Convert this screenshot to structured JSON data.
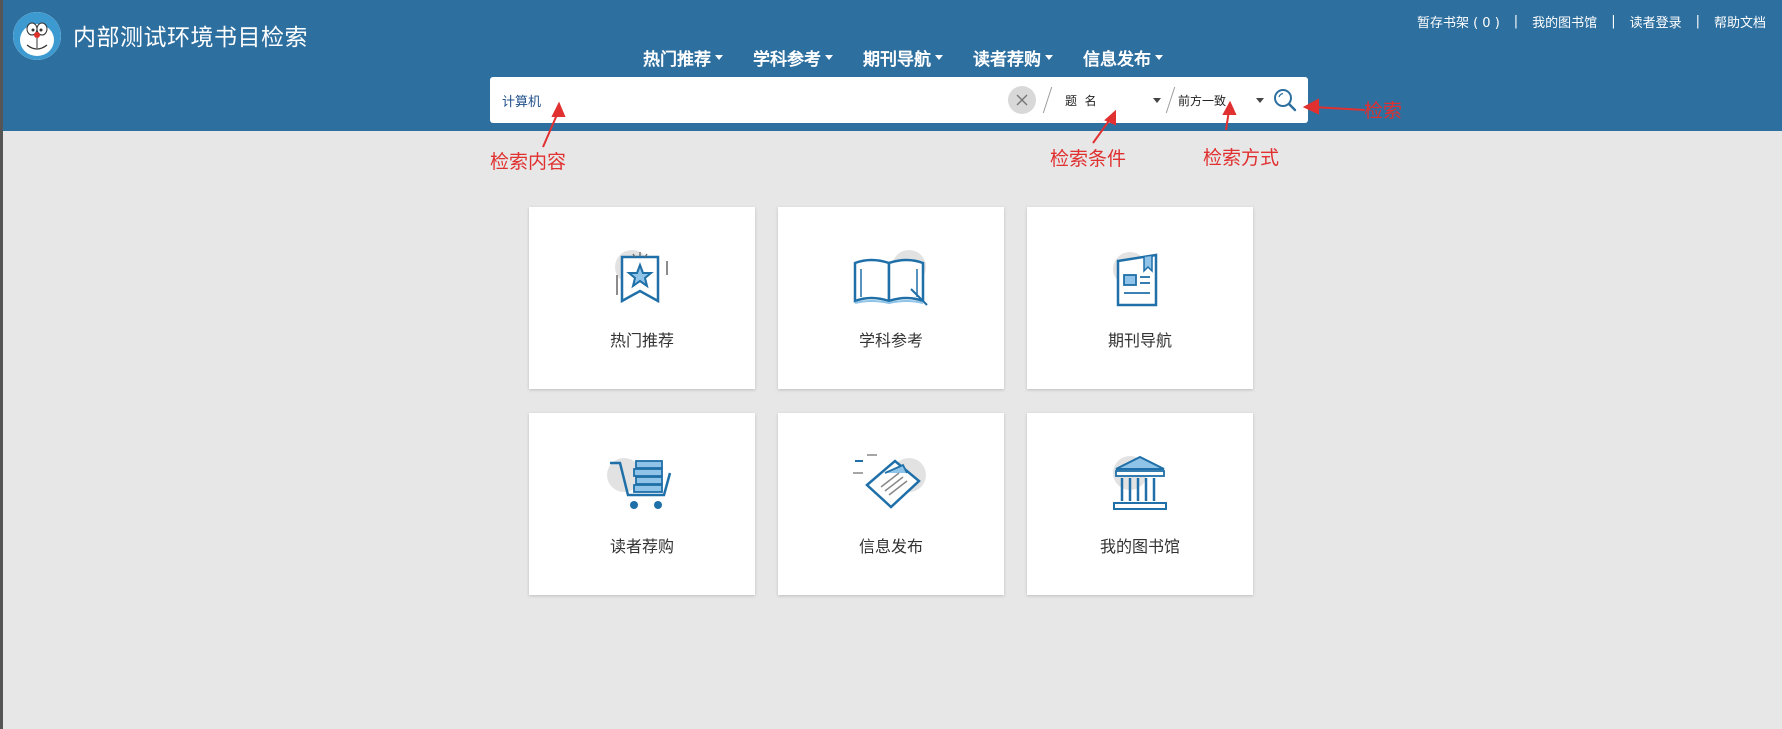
{
  "header": {
    "title": "内部测试环境书目检索",
    "top_links": [
      "暂存书架 ( 0 )",
      "我的图书馆",
      "读者登录",
      "帮助文档"
    ],
    "separator": "|"
  },
  "nav": [
    {
      "label": "热门推荐"
    },
    {
      "label": "学科参考"
    },
    {
      "label": "期刊导航"
    },
    {
      "label": "读者荐购"
    },
    {
      "label": "信息发布"
    }
  ],
  "search": {
    "value": "计算机",
    "field": "题  名",
    "mode": "前方一致"
  },
  "annotations": {
    "content": "检索内容",
    "condition": "检索条件",
    "method": "检索方式",
    "search": "检索"
  },
  "cards": [
    {
      "label": "热门推荐",
      "icon": "bookmark-star-icon"
    },
    {
      "label": "学科参考",
      "icon": "open-book-icon"
    },
    {
      "label": "期刊导航",
      "icon": "journal-icon"
    },
    {
      "label": "读者荐购",
      "icon": "cart-books-icon"
    },
    {
      "label": "信息发布",
      "icon": "publish-document-icon"
    },
    {
      "label": "我的图书馆",
      "icon": "library-building-icon"
    }
  ],
  "colors": {
    "header": "#2d6f9f",
    "accent_icon": "#1f6fa8",
    "annotation": "#e03030",
    "background": "#e7e7e7"
  }
}
